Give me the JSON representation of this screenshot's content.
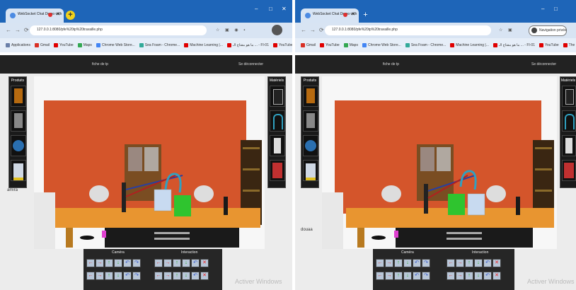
{
  "windows": {
    "left": {
      "tab_title": "WebSocket Chat Demo with",
      "url": "127.0.0.1:8080/pfe%20tp%20travaille.php",
      "nav_menu": "fiche de tp",
      "disconnect": "Se déconnecter",
      "left_panel_title": "Produits",
      "right_panel_title": "Matériels",
      "username": "amira",
      "camera_label": "Caméra",
      "interaction_label": "Interaction",
      "watermark": "Activer Windows",
      "bookmarks": [
        {
          "label": "Applications",
          "color": "#6a7fa8"
        },
        {
          "label": "Gmail",
          "color": "#d93025"
        },
        {
          "label": "YouTube",
          "color": "#e00000"
        },
        {
          "label": "Maps",
          "color": "#34a853"
        },
        {
          "label": "Chrome Web Store...",
          "color": "#4285f4"
        },
        {
          "label": "Sea Foam - Chrome...",
          "color": "#3a9"
        },
        {
          "label": "Machine Learning |...",
          "color": "#e00000"
        },
        {
          "label": "ما هو مفتاح الـ ... - FI-01",
          "color": "#e00000"
        },
        {
          "label": "YouTube",
          "color": "#e00000"
        }
      ]
    },
    "right": {
      "tab_title": "WebSocket Chat Demo with",
      "url": "127.0.0.1:8080/pfe%20tp%20travaille.php",
      "incognito": "Navigation privée",
      "nav_menu": "fiche de tp",
      "disconnect": "Se déconnecter",
      "left_panel_title": "Produits",
      "right_panel_title": "Matériels",
      "username": "douaa",
      "camera_label": "Caméra",
      "interaction_label": "Interaction",
      "watermark": "Activer Windows",
      "bookmarks": [
        {
          "label": "Gmail",
          "color": "#d93025"
        },
        {
          "label": "YouTube",
          "color": "#e00000"
        },
        {
          "label": "Maps",
          "color": "#34a853"
        },
        {
          "label": "Chrome Web Store...",
          "color": "#4285f4"
        },
        {
          "label": "Sea Foam - Chrome...",
          "color": "#3a9"
        },
        {
          "label": "Machine Learning |...",
          "color": "#e00000"
        },
        {
          "label": "ما هو مفتاح الـ ... - FI-01",
          "color": "#e00000"
        },
        {
          "label": "YouTube",
          "color": "#e00000"
        },
        {
          "label": "The Kernel Trick - I...",
          "color": "#e00000"
        }
      ]
    }
  },
  "colors": {
    "titlebar": "#1e65b8",
    "wall": "#d4552b",
    "table": "#e89530",
    "green_beaker": "#2fc42f"
  },
  "icons": {
    "camera_buttons": [
      "arrow-left-icon",
      "arrow-right-icon",
      "arrow-up-icon",
      "arrow-down-icon",
      "rotate-left-icon",
      "rotate-right-icon"
    ],
    "interaction_buttons": [
      "arrow-left-icon",
      "arrow-right-icon",
      "arrow-up-icon",
      "arrow-down-icon",
      "rotate-left-icon",
      "delete-icon"
    ]
  }
}
